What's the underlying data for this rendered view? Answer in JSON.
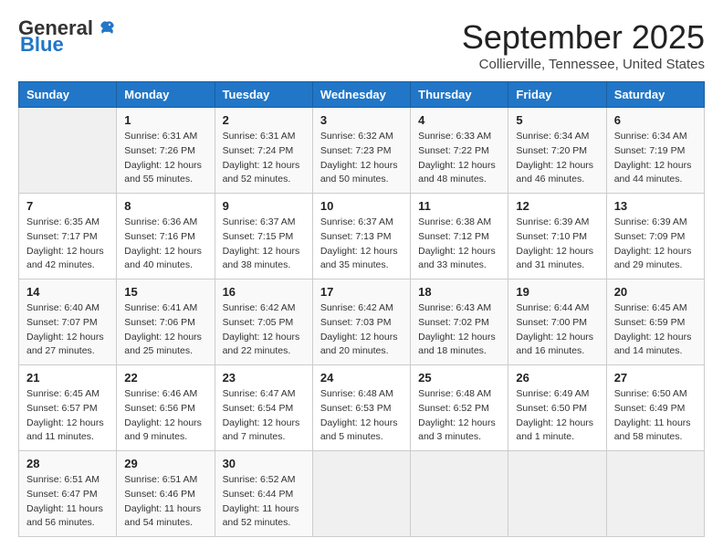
{
  "header": {
    "logo_general": "General",
    "logo_blue": "Blue",
    "month": "September 2025",
    "location": "Collierville, Tennessee, United States"
  },
  "weekdays": [
    "Sunday",
    "Monday",
    "Tuesday",
    "Wednesday",
    "Thursday",
    "Friday",
    "Saturday"
  ],
  "weeks": [
    [
      {
        "day": "",
        "info": ""
      },
      {
        "day": "1",
        "info": "Sunrise: 6:31 AM\nSunset: 7:26 PM\nDaylight: 12 hours\nand 55 minutes."
      },
      {
        "day": "2",
        "info": "Sunrise: 6:31 AM\nSunset: 7:24 PM\nDaylight: 12 hours\nand 52 minutes."
      },
      {
        "day": "3",
        "info": "Sunrise: 6:32 AM\nSunset: 7:23 PM\nDaylight: 12 hours\nand 50 minutes."
      },
      {
        "day": "4",
        "info": "Sunrise: 6:33 AM\nSunset: 7:22 PM\nDaylight: 12 hours\nand 48 minutes."
      },
      {
        "day": "5",
        "info": "Sunrise: 6:34 AM\nSunset: 7:20 PM\nDaylight: 12 hours\nand 46 minutes."
      },
      {
        "day": "6",
        "info": "Sunrise: 6:34 AM\nSunset: 7:19 PM\nDaylight: 12 hours\nand 44 minutes."
      }
    ],
    [
      {
        "day": "7",
        "info": "Sunrise: 6:35 AM\nSunset: 7:17 PM\nDaylight: 12 hours\nand 42 minutes."
      },
      {
        "day": "8",
        "info": "Sunrise: 6:36 AM\nSunset: 7:16 PM\nDaylight: 12 hours\nand 40 minutes."
      },
      {
        "day": "9",
        "info": "Sunrise: 6:37 AM\nSunset: 7:15 PM\nDaylight: 12 hours\nand 38 minutes."
      },
      {
        "day": "10",
        "info": "Sunrise: 6:37 AM\nSunset: 7:13 PM\nDaylight: 12 hours\nand 35 minutes."
      },
      {
        "day": "11",
        "info": "Sunrise: 6:38 AM\nSunset: 7:12 PM\nDaylight: 12 hours\nand 33 minutes."
      },
      {
        "day": "12",
        "info": "Sunrise: 6:39 AM\nSunset: 7:10 PM\nDaylight: 12 hours\nand 31 minutes."
      },
      {
        "day": "13",
        "info": "Sunrise: 6:39 AM\nSunset: 7:09 PM\nDaylight: 12 hours\nand 29 minutes."
      }
    ],
    [
      {
        "day": "14",
        "info": "Sunrise: 6:40 AM\nSunset: 7:07 PM\nDaylight: 12 hours\nand 27 minutes."
      },
      {
        "day": "15",
        "info": "Sunrise: 6:41 AM\nSunset: 7:06 PM\nDaylight: 12 hours\nand 25 minutes."
      },
      {
        "day": "16",
        "info": "Sunrise: 6:42 AM\nSunset: 7:05 PM\nDaylight: 12 hours\nand 22 minutes."
      },
      {
        "day": "17",
        "info": "Sunrise: 6:42 AM\nSunset: 7:03 PM\nDaylight: 12 hours\nand 20 minutes."
      },
      {
        "day": "18",
        "info": "Sunrise: 6:43 AM\nSunset: 7:02 PM\nDaylight: 12 hours\nand 18 minutes."
      },
      {
        "day": "19",
        "info": "Sunrise: 6:44 AM\nSunset: 7:00 PM\nDaylight: 12 hours\nand 16 minutes."
      },
      {
        "day": "20",
        "info": "Sunrise: 6:45 AM\nSunset: 6:59 PM\nDaylight: 12 hours\nand 14 minutes."
      }
    ],
    [
      {
        "day": "21",
        "info": "Sunrise: 6:45 AM\nSunset: 6:57 PM\nDaylight: 12 hours\nand 11 minutes."
      },
      {
        "day": "22",
        "info": "Sunrise: 6:46 AM\nSunset: 6:56 PM\nDaylight: 12 hours\nand 9 minutes."
      },
      {
        "day": "23",
        "info": "Sunrise: 6:47 AM\nSunset: 6:54 PM\nDaylight: 12 hours\nand 7 minutes."
      },
      {
        "day": "24",
        "info": "Sunrise: 6:48 AM\nSunset: 6:53 PM\nDaylight: 12 hours\nand 5 minutes."
      },
      {
        "day": "25",
        "info": "Sunrise: 6:48 AM\nSunset: 6:52 PM\nDaylight: 12 hours\nand 3 minutes."
      },
      {
        "day": "26",
        "info": "Sunrise: 6:49 AM\nSunset: 6:50 PM\nDaylight: 12 hours\nand 1 minute."
      },
      {
        "day": "27",
        "info": "Sunrise: 6:50 AM\nSunset: 6:49 PM\nDaylight: 11 hours\nand 58 minutes."
      }
    ],
    [
      {
        "day": "28",
        "info": "Sunrise: 6:51 AM\nSunset: 6:47 PM\nDaylight: 11 hours\nand 56 minutes."
      },
      {
        "day": "29",
        "info": "Sunrise: 6:51 AM\nSunset: 6:46 PM\nDaylight: 11 hours\nand 54 minutes."
      },
      {
        "day": "30",
        "info": "Sunrise: 6:52 AM\nSunset: 6:44 PM\nDaylight: 11 hours\nand 52 minutes."
      },
      {
        "day": "",
        "info": ""
      },
      {
        "day": "",
        "info": ""
      },
      {
        "day": "",
        "info": ""
      },
      {
        "day": "",
        "info": ""
      }
    ]
  ]
}
